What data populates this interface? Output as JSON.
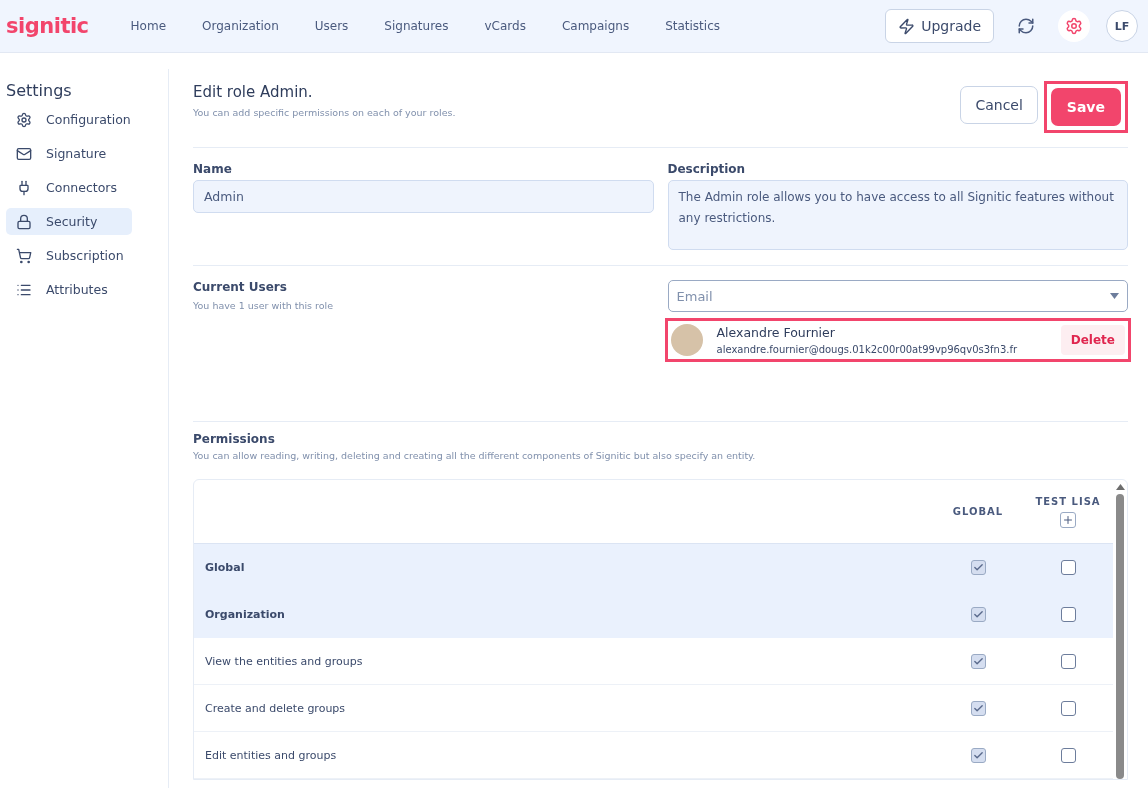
{
  "header": {
    "logo": "signitic",
    "nav": [
      {
        "label": "Home"
      },
      {
        "label": "Organization"
      },
      {
        "label": "Users"
      },
      {
        "label": "Signatures"
      },
      {
        "label": "vCards"
      },
      {
        "label": "Campaigns"
      },
      {
        "label": "Statistics"
      }
    ],
    "upgrade": "Upgrade",
    "avatar": "LF"
  },
  "sidebar": {
    "title": "Settings",
    "items": [
      {
        "label": "Configuration",
        "selected": false
      },
      {
        "label": "Signature",
        "selected": false
      },
      {
        "label": "Connectors",
        "selected": false
      },
      {
        "label": "Security",
        "selected": true
      },
      {
        "label": "Subscription",
        "selected": false
      },
      {
        "label": "Attributes",
        "selected": false
      }
    ]
  },
  "page": {
    "title": "Edit role Admin.",
    "subtitle": "You can add specific permissions on each of your roles.",
    "cancel": "Cancel",
    "save": {
      "label": "Save",
      "highlighted": true
    }
  },
  "name": {
    "label": "Name",
    "value": "Admin"
  },
  "description": {
    "label": "Description",
    "value": "The Admin role allows you to have access to all Signitic features without any restrictions."
  },
  "users": {
    "label": "Current Users",
    "subtitle": "You have 1 user with this role",
    "email_placeholder": "Email",
    "list": [
      {
        "name": "Alexandre Fournier",
        "email": "alexandre.fournier@dougs.01k2c00r00at99vp96qv0s3fn3.fr",
        "action": "Delete",
        "highlighted": true
      }
    ]
  },
  "permissions": {
    "label": "Permissions",
    "subtitle": "You can allow reading, writing, deleting and creating all the different components of Signitic but also specify an entity.",
    "columns": [
      {
        "label": "GLOBAL",
        "addable": false
      },
      {
        "label": "TEST LISA",
        "addable": true
      }
    ],
    "rows": [
      {
        "label": "Global",
        "kind": "group",
        "checks": [
          true,
          false
        ]
      },
      {
        "label": "Organization",
        "kind": "group",
        "checks": [
          true,
          false
        ]
      },
      {
        "label": "View the entities and groups",
        "kind": "item",
        "checks": [
          true,
          false
        ]
      },
      {
        "label": "Create and delete groups",
        "kind": "item",
        "checks": [
          true,
          false
        ]
      },
      {
        "label": "Edit entities and groups",
        "kind": "item",
        "checks": [
          true,
          false
        ]
      }
    ]
  }
}
